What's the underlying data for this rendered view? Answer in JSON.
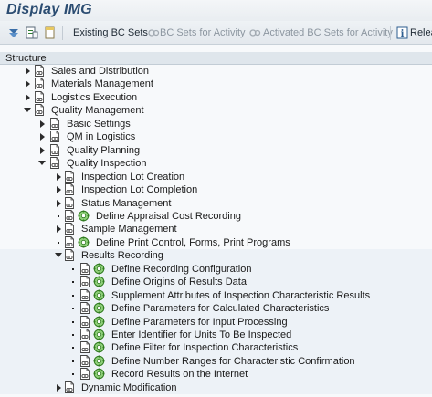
{
  "window": {
    "title": "Display IMG"
  },
  "toolbar": {
    "existing_bc_sets": "Existing BC Sets",
    "bc_sets_for_activity": "BC Sets for Activity",
    "activated_bc_sets_for_activity": "Activated BC Sets for Activity",
    "release": "Relea"
  },
  "tree": {
    "header": "Structure",
    "items": [
      {
        "label": "Sales and Distribution",
        "level": 0,
        "state": "collapsed",
        "activity": false
      },
      {
        "label": "Materials Management",
        "level": 0,
        "state": "collapsed",
        "activity": false
      },
      {
        "label": "Logistics Execution",
        "level": 0,
        "state": "collapsed",
        "activity": false
      },
      {
        "label": "Quality Management",
        "level": 0,
        "state": "expanded",
        "activity": false
      },
      {
        "label": "Basic Settings",
        "level": 1,
        "state": "collapsed",
        "activity": false
      },
      {
        "label": "QM in Logistics",
        "level": 1,
        "state": "collapsed",
        "activity": false
      },
      {
        "label": "Quality Planning",
        "level": 1,
        "state": "collapsed",
        "activity": false
      },
      {
        "label": "Quality Inspection",
        "level": 1,
        "state": "expanded",
        "activity": false
      },
      {
        "label": "Inspection Lot Creation",
        "level": 2,
        "state": "collapsed",
        "activity": false
      },
      {
        "label": "Inspection Lot Completion",
        "level": 2,
        "state": "collapsed",
        "activity": false
      },
      {
        "label": "Status Management",
        "level": 2,
        "state": "collapsed",
        "activity": false
      },
      {
        "label": "Define Appraisal Cost Recording",
        "level": 2,
        "state": "leaf",
        "activity": true
      },
      {
        "label": "Sample Management",
        "level": 2,
        "state": "collapsed",
        "activity": false
      },
      {
        "label": "Define Print Control, Forms, Print Programs",
        "level": 2,
        "state": "leaf",
        "activity": true
      },
      {
        "label": "Results Recording",
        "level": 2,
        "state": "expanded",
        "activity": false
      },
      {
        "label": "Define Recording Configuration",
        "level": 3,
        "state": "leaf",
        "activity": true
      },
      {
        "label": "Define Origins of Results Data",
        "level": 3,
        "state": "leaf",
        "activity": true
      },
      {
        "label": "Supplement Attributes of Inspection Characteristic Results",
        "level": 3,
        "state": "leaf",
        "activity": true
      },
      {
        "label": "Define Parameters for Calculated Characteristics",
        "level": 3,
        "state": "leaf",
        "activity": true
      },
      {
        "label": "Define Parameters for Input Processing",
        "level": 3,
        "state": "leaf",
        "activity": true
      },
      {
        "label": "Enter Identifier for Units To Be Inspected",
        "level": 3,
        "state": "leaf",
        "activity": true
      },
      {
        "label": "Define Filter for Inspection Characteristics",
        "level": 3,
        "state": "leaf",
        "activity": true
      },
      {
        "label": "Define Number Ranges for Characteristic Confirmation",
        "level": 3,
        "state": "leaf",
        "activity": true
      },
      {
        "label": "Record Results on the Internet",
        "level": 3,
        "state": "leaf",
        "activity": true
      },
      {
        "label": "Dynamic Modification",
        "level": 2,
        "state": "collapsed",
        "activity": false
      }
    ]
  }
}
